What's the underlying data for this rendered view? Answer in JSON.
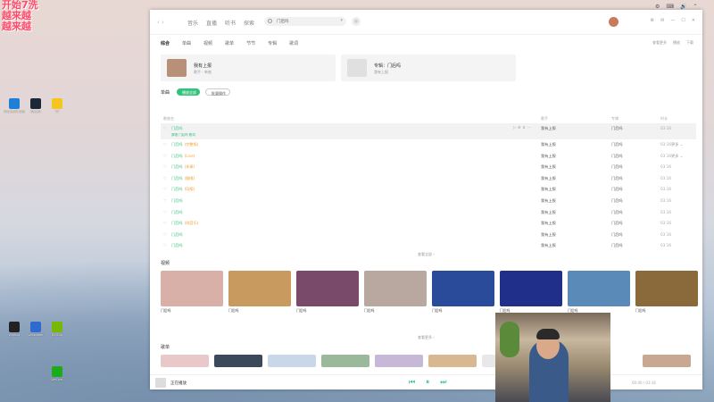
{
  "overlay": {
    "line1": "开始7洗",
    "line2": "越来越",
    "line3": "越来越"
  },
  "desktop": {
    "icons": [
      {
        "label": "Microsoft Edge"
      },
      {
        "label": "Steam"
      },
      {
        "label": "YY"
      },
      {
        "label": "Winbox"
      },
      {
        "label": "Wallpaper"
      },
      {
        "label": "NVIDIA"
      },
      {
        "label": "WeChat"
      }
    ]
  },
  "window": {
    "nav": {
      "back": "‹",
      "forward": "›"
    },
    "topnav": [
      "音乐",
      "直播",
      "听书",
      "探索"
    ],
    "search": {
      "value": "门后吗"
    },
    "mic": "◎",
    "winbtns": [
      "⚙",
      "✉",
      "—",
      "☐",
      "✕"
    ],
    "tabs": [
      "综合",
      "单曲",
      "视频",
      "歌单",
      "节节",
      "专辑",
      "歌词"
    ],
    "toplinks": [
      "查看更多",
      "播放",
      "下载"
    ],
    "cards": [
      {
        "name": "我有上报",
        "sub": "歌手 · 单曲"
      },
      {
        "name": "专辑：门后吗",
        "sub": "我有上报"
      }
    ],
    "songs_label": "单曲",
    "pills": [
      {
        "label": "播放全部"
      },
      {
        "label": "批量操作"
      }
    ],
    "table": {
      "headers": {
        "title": "歌曲名",
        "singer": "歌手",
        "album": "专辑",
        "dur": "时长"
      },
      "rows": [
        {
          "title": "门后吗",
          "tag": "",
          "sub": "原唱 门后吗 歌词",
          "singer": "我有上报",
          "album": "门后吗",
          "dur": "03:16",
          "more": ""
        },
        {
          "title": "门后吗",
          "tag": "(完整版)",
          "sub": "",
          "singer": "我有上报",
          "album": "门后吗",
          "dur": "03:16",
          "more": "更多 ⌄"
        },
        {
          "title": "门后吗",
          "tag": "(Live)",
          "sub": "",
          "singer": "我有上报",
          "album": "门后吗",
          "dur": "03:16",
          "more": "更多 ⌄"
        },
        {
          "title": "门后吗",
          "tag": "(伴奏)",
          "sub": "",
          "singer": "我有上报",
          "album": "门后吗",
          "dur": "03:16",
          "more": ""
        },
        {
          "title": "门后吗",
          "tag": "(翻唱)",
          "sub": "",
          "singer": "我有上报",
          "album": "门后吗",
          "dur": "03:16",
          "more": ""
        },
        {
          "title": "门后吗",
          "tag": "(DJ版)",
          "sub": "",
          "singer": "我有上报",
          "album": "门后吗",
          "dur": "03:16",
          "more": ""
        },
        {
          "title": "门后吗",
          "tag": "",
          "sub": "",
          "singer": "我有上报",
          "album": "门后吗",
          "dur": "03:16",
          "more": ""
        },
        {
          "title": "门后吗",
          "tag": "",
          "sub": "",
          "singer": "我有上报",
          "album": "门后吗",
          "dur": "03:16",
          "more": ""
        },
        {
          "title": "门后吗",
          "tag": "(纯音乐)",
          "sub": "",
          "singer": "我有上报",
          "album": "门后吗",
          "dur": "03:16",
          "more": ""
        },
        {
          "title": "门后吗",
          "tag": "",
          "sub": "",
          "singer": "我有上报",
          "album": "门后吗",
          "dur": "03:16",
          "more": ""
        },
        {
          "title": "门后吗",
          "tag": "",
          "sub": "",
          "singer": "我有上报",
          "album": "门后吗",
          "dur": "03:16",
          "more": ""
        }
      ]
    },
    "more_songs": "查看全部 ›",
    "videos_label": "视频",
    "videos": [
      {
        "cap": "门后吗",
        "cap2": "",
        "color": "#d8b0a8"
      },
      {
        "cap": "门后吗",
        "cap2": "",
        "color": "#c89a60"
      },
      {
        "cap": "门后吗",
        "cap2": "",
        "color": "#7a4a6a"
      },
      {
        "cap": "门后吗",
        "cap2": "",
        "color": "#b8a8a0"
      },
      {
        "cap": "门后吗",
        "cap2": "",
        "color": "#2a4a9a"
      },
      {
        "cap": "门后吗",
        "cap2": "",
        "color": "#20308a"
      },
      {
        "cap": "门后吗",
        "cap2": "",
        "color": "#5a8ab8"
      },
      {
        "cap": "门后吗",
        "cap2": "",
        "color": "#8a6a3a"
      }
    ],
    "more_videos": "查看更多 ›",
    "playlists_label": "歌单",
    "playlist_colors": [
      "#e8c8c8",
      "#3a4a5a",
      "#c8d8e8",
      "#9ab89a",
      "#c8b8d8",
      "#d8b890",
      "#e8e8e8",
      "#c8a890"
    ],
    "player": {
      "title": "正在播放",
      "prev": "⏮",
      "play": "⏸",
      "next": "⏭",
      "time": "00:00 / 03:16"
    }
  },
  "tray": [
    "⚙",
    "⌨",
    "🔊",
    "⌃"
  ]
}
